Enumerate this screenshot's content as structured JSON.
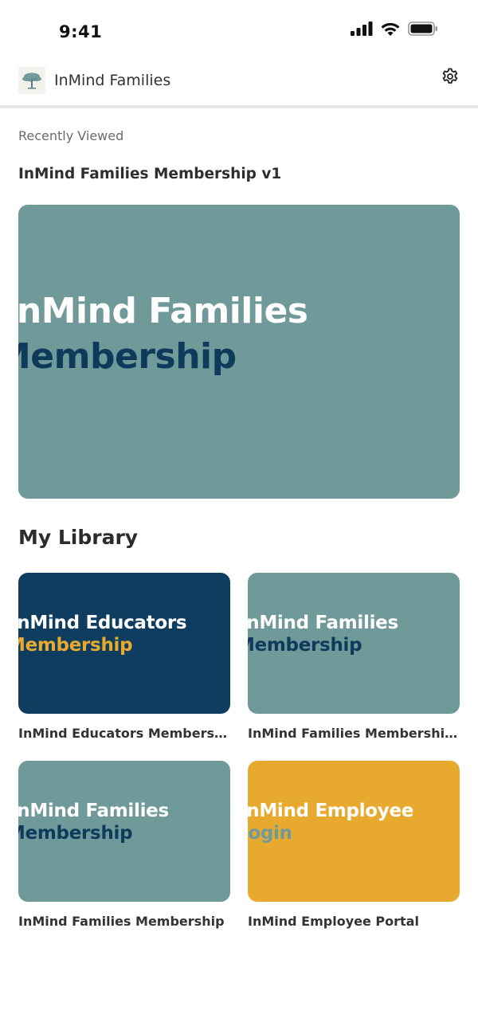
{
  "status": {
    "time": "9:41"
  },
  "header": {
    "title": "InMind Families"
  },
  "recent": {
    "label": "Recently Viewed",
    "title": "InMind Families Membership v1",
    "card": {
      "line1": "InMind Families",
      "line2": "Membership",
      "bg": "#6f9a99",
      "line1_color": "#ffffff",
      "line2_color": "#0f3a5c"
    }
  },
  "library": {
    "title": "My Library",
    "items": [
      {
        "line1": "InMind Educators",
        "line2": "Membership",
        "label": "InMind Educators Membership",
        "bg": "#0f3d60",
        "line1_color": "#ffffff",
        "line2_color": "#e8aa2e"
      },
      {
        "line1": "InMind Families",
        "line2": "Membership",
        "label": "InMind Families Membership- …",
        "bg": "#6f9a99",
        "line1_color": "#ffffff",
        "line2_color": "#0f3a5c"
      },
      {
        "line1": "InMind Families",
        "line2": "Membership",
        "label": "InMind Families Membership",
        "bg": "#6f9a99",
        "line1_color": "#ffffff",
        "line2_color": "#0f3a5c"
      },
      {
        "line1": "InMind Employee",
        "line2": "Login",
        "label": "InMind Employee Portal",
        "bg": "#e8aa2e",
        "line1_color": "#ffffff",
        "line2_color": "#6f9a99"
      }
    ]
  },
  "icons": {
    "signal": "signal-icon",
    "wifi": "wifi-icon",
    "battery": "battery-icon",
    "settings": "gear-icon",
    "logo": "tree-logo-icon"
  }
}
